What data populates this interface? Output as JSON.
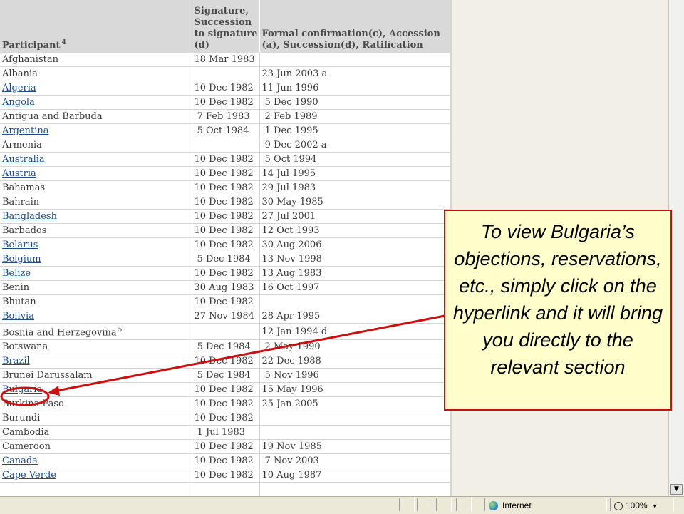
{
  "table": {
    "headers": {
      "participant": "Participant",
      "participant_note": "4",
      "signature": "Signature, Succession to signature (d)",
      "confirmation": "Formal confirmation(c), Accession (a), Succession(d), Ratification"
    },
    "rows": [
      {
        "name": "Afghanistan",
        "note": "",
        "sig": "18 Mar 1983",
        "conf": "",
        "link": false
      },
      {
        "name": "Albania",
        "note": "",
        "sig": "",
        "conf": "23 Jun 2003 a",
        "link": false
      },
      {
        "name": "Algeria",
        "note": "",
        "sig": "10 Dec 1982",
        "conf": "11 Jun 1996",
        "link": true
      },
      {
        "name": "Angola",
        "note": "",
        "sig": "10 Dec 1982",
        "conf": " 5 Dec 1990",
        "link": true
      },
      {
        "name": "Antigua and Barbuda",
        "note": "",
        "sig": " 7 Feb 1983",
        "conf": " 2 Feb 1989",
        "link": false
      },
      {
        "name": "Argentina",
        "note": "",
        "sig": " 5 Oct 1984",
        "conf": " 1 Dec 1995",
        "link": true
      },
      {
        "name": "Armenia",
        "note": "",
        "sig": "",
        "conf": " 9 Dec 2002 a",
        "link": false
      },
      {
        "name": "Australia",
        "note": "",
        "sig": "10 Dec 1982",
        "conf": " 5 Oct 1994",
        "link": true
      },
      {
        "name": "Austria",
        "note": "",
        "sig": "10 Dec 1982",
        "conf": "14 Jul 1995",
        "link": true
      },
      {
        "name": "Bahamas",
        "note": "",
        "sig": "10 Dec 1982",
        "conf": "29 Jul 1983",
        "link": false
      },
      {
        "name": "Bahrain",
        "note": "",
        "sig": "10 Dec 1982",
        "conf": "30 May 1985",
        "link": false
      },
      {
        "name": "Bangladesh",
        "note": "",
        "sig": "10 Dec 1982",
        "conf": "27 Jul 2001",
        "link": true
      },
      {
        "name": "Barbados",
        "note": "",
        "sig": "10 Dec 1982",
        "conf": "12 Oct 1993",
        "link": false
      },
      {
        "name": "Belarus",
        "note": "",
        "sig": "10 Dec 1982",
        "conf": "30 Aug 2006",
        "link": true
      },
      {
        "name": "Belgium",
        "note": "",
        "sig": " 5 Dec 1984",
        "conf": "13 Nov 1998",
        "link": true
      },
      {
        "name": "Belize",
        "note": "",
        "sig": "10 Dec 1982",
        "conf": "13 Aug 1983",
        "link": true
      },
      {
        "name": "Benin",
        "note": "",
        "sig": "30 Aug 1983",
        "conf": "16 Oct 1997",
        "link": false
      },
      {
        "name": "Bhutan",
        "note": "",
        "sig": "10 Dec 1982",
        "conf": "",
        "link": false
      },
      {
        "name": "Bolivia",
        "note": "",
        "sig": "27 Nov 1984",
        "conf": "28 Apr 1995",
        "link": true
      },
      {
        "name": "Bosnia and Herzegovina",
        "note": "5",
        "sig": "",
        "conf": "12 Jan 1994 d",
        "link": false
      },
      {
        "name": "Botswana",
        "note": "",
        "sig": " 5 Dec 1984",
        "conf": " 2 May 1990",
        "link": false
      },
      {
        "name": "Brazil",
        "note": "",
        "sig": "10 Dec 1982",
        "conf": "22 Dec 1988",
        "link": true
      },
      {
        "name": "Brunei Darussalam",
        "note": "",
        "sig": " 5 Dec 1984",
        "conf": " 5 Nov 1996",
        "link": false
      },
      {
        "name": "Bulgaria",
        "note": "",
        "sig": "10 Dec 1982",
        "conf": "15 May 1996",
        "link": true
      },
      {
        "name": "Burkina Faso",
        "note": "",
        "sig": "10 Dec 1982",
        "conf": "25 Jan 2005",
        "link": false
      },
      {
        "name": "Burundi",
        "note": "",
        "sig": "10 Dec 1982",
        "conf": "",
        "link": false
      },
      {
        "name": "Cambodia",
        "note": "",
        "sig": " 1 Jul 1983",
        "conf": "",
        "link": false
      },
      {
        "name": "Cameroon",
        "note": "",
        "sig": "10 Dec 1982",
        "conf": "19 Nov 1985",
        "link": false
      },
      {
        "name": "Canada",
        "note": "",
        "sig": "10 Dec 1982",
        "conf": " 7 Nov 2003",
        "link": true
      },
      {
        "name": "Cape Verde",
        "note": "",
        "sig": "10 Dec 1982",
        "conf": "10 Aug 1987",
        "link": true
      },
      {
        "name": "",
        "note": "",
        "sig": "",
        "conf": "",
        "link": false
      }
    ]
  },
  "callout": {
    "text": "To view Bulgaria’s objections, reservations, etc., simply click on the hyperlink and it will bring you directly to the relevant section"
  },
  "statusbar": {
    "zone": "Internet",
    "zoom": "100%"
  },
  "colors": {
    "annotation": "#cc1010",
    "callout_bg": "#ffffcc",
    "link": "#1e4d88",
    "header_bg": "#d9d9d9"
  }
}
